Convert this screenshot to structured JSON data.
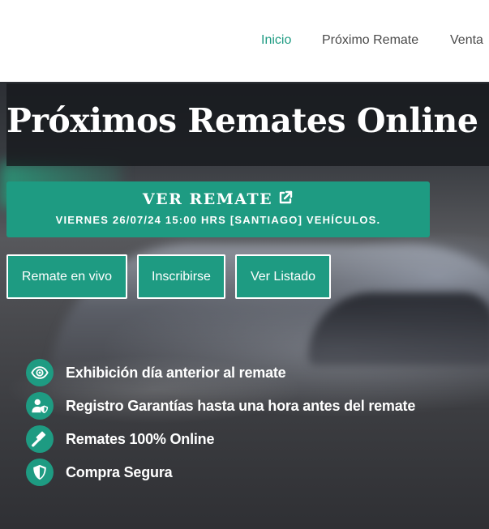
{
  "nav": {
    "items": [
      {
        "label": "Inicio",
        "active": true
      },
      {
        "label": "Próximo Remate",
        "active": false
      },
      {
        "label": "Venta",
        "active": false
      }
    ]
  },
  "hero": {
    "title": "Próximos Remates Online",
    "cta": {
      "title": "VER REMATE",
      "icon": "external-link-icon",
      "subtitle": "VIERNES 26/07/24 15:00 HRS [SANTIAGO] VEHÍCULOS."
    },
    "buttons": [
      {
        "label": "Remate en vivo"
      },
      {
        "label": "Inscribirse"
      },
      {
        "label": "Ver Listado"
      }
    ],
    "features": [
      {
        "icon": "eye-icon",
        "label": "Exhibición día anterior al remate"
      },
      {
        "icon": "user-shield-icon",
        "label": "Registro Garantías hasta una hora antes del remate"
      },
      {
        "icon": "gavel-icon",
        "label": "Remates 100% Online"
      },
      {
        "icon": "shield-icon",
        "label": "Compra Segura"
      }
    ]
  },
  "colors": {
    "accent": "#1e9b82",
    "nav_text": "#4a4a4a",
    "title_band": "#16181c"
  }
}
